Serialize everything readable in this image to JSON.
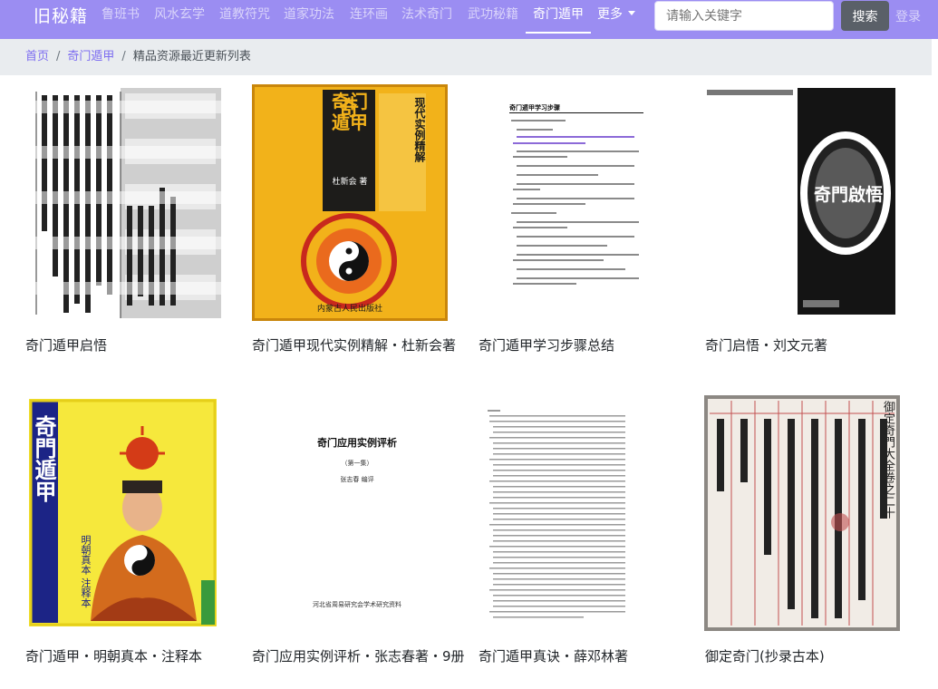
{
  "brand": "旧秘籍",
  "nav": {
    "items": [
      {
        "label": "鲁班书"
      },
      {
        "label": "风水玄学"
      },
      {
        "label": "道教符咒"
      },
      {
        "label": "道家功法"
      },
      {
        "label": "连环画"
      },
      {
        "label": "法术奇门"
      },
      {
        "label": "武功秘籍"
      },
      {
        "label": "奇门遁甲",
        "active": true
      },
      {
        "label": "更多"
      }
    ],
    "search_placeholder": "请输入关键字",
    "search_button": "搜索",
    "login": "登录"
  },
  "breadcrumb": {
    "home": "首页",
    "category": "奇门遁甲",
    "current": "精品资源最近更新列表"
  },
  "books": [
    {
      "title": "奇门遁甲启悟"
    },
    {
      "title": "奇门遁甲现代实例精解・杜新会著",
      "cover_title": "奇门遁甲",
      "cover_subtitle": "现代实例精解",
      "cover_author": "杜新会 著",
      "cover_publisher": "内蒙古人民出版社"
    },
    {
      "title": "奇门遁甲学习步骤总结",
      "doc_heading": "奇门遁甲学习步骤"
    },
    {
      "title": "奇门启悟・刘文元著",
      "cover_title": "奇門啟悟"
    },
    {
      "title": "奇门遁甲・明朝真本・注释本",
      "cover_title": "奇門遁甲",
      "cover_note": "明朝真本 注释本"
    },
    {
      "title": "奇门应用实例评析・张志春著・9册",
      "doc_heading": "奇门应用实例评析",
      "doc_sub": "（第一集）",
      "doc_author": "张志春 编评",
      "doc_footer": "河北省周易研究会学术研究资料"
    },
    {
      "title": "奇门遁甲真诀・薛邓林著"
    },
    {
      "title": "御定奇门(抄录古本)",
      "ms_heading": "御定奇門大全卷之二十"
    }
  ],
  "colors": {
    "navbar": "#9b8df2",
    "accent": "#7d6df0",
    "breadcrumb_bg": "#e9ecef",
    "search_button": "#5a6068"
  }
}
